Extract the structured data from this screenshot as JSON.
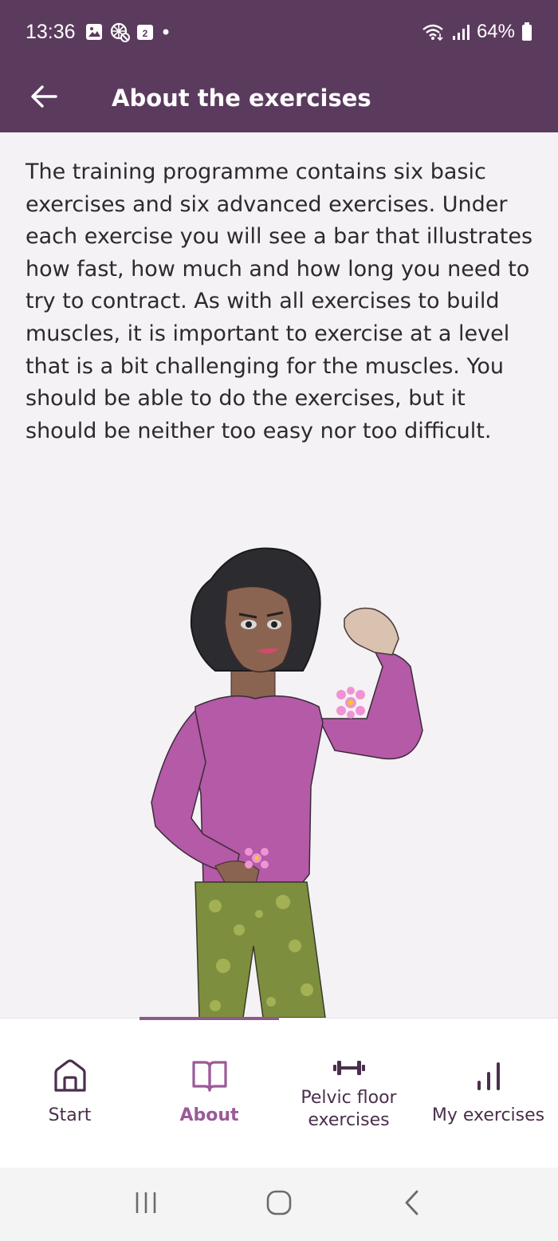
{
  "status_bar": {
    "time": "13:36",
    "battery": "64%",
    "calendar_day": "2"
  },
  "app_bar": {
    "title": "About the exercises",
    "back_icon": "arrow-left-icon"
  },
  "intro": {
    "text": "The training programme contains six basic exercises and six advanced exercises. Under each exercise you will see a bar that illustrates how fast, how much and how long you need to try to contract. As with all exercises to build muscles, it is important to exercise at a level that is a bit challenging for the muscles. You should be able to do the exercises, but it should be neither too easy nor too difficult."
  },
  "bottom_nav": {
    "items": [
      {
        "label": "Start",
        "icon": "home-icon"
      },
      {
        "label": "About",
        "icon": "book-icon"
      },
      {
        "label": "Pelvic floor\nexercises",
        "icon": "dumbbell-icon"
      },
      {
        "label": "My exercises",
        "icon": "bar-chart-icon"
      }
    ],
    "active_index": 1
  },
  "colors": {
    "primary": "#5b3b5d",
    "active": "#9a5a98",
    "background": "#f4f2f4"
  }
}
